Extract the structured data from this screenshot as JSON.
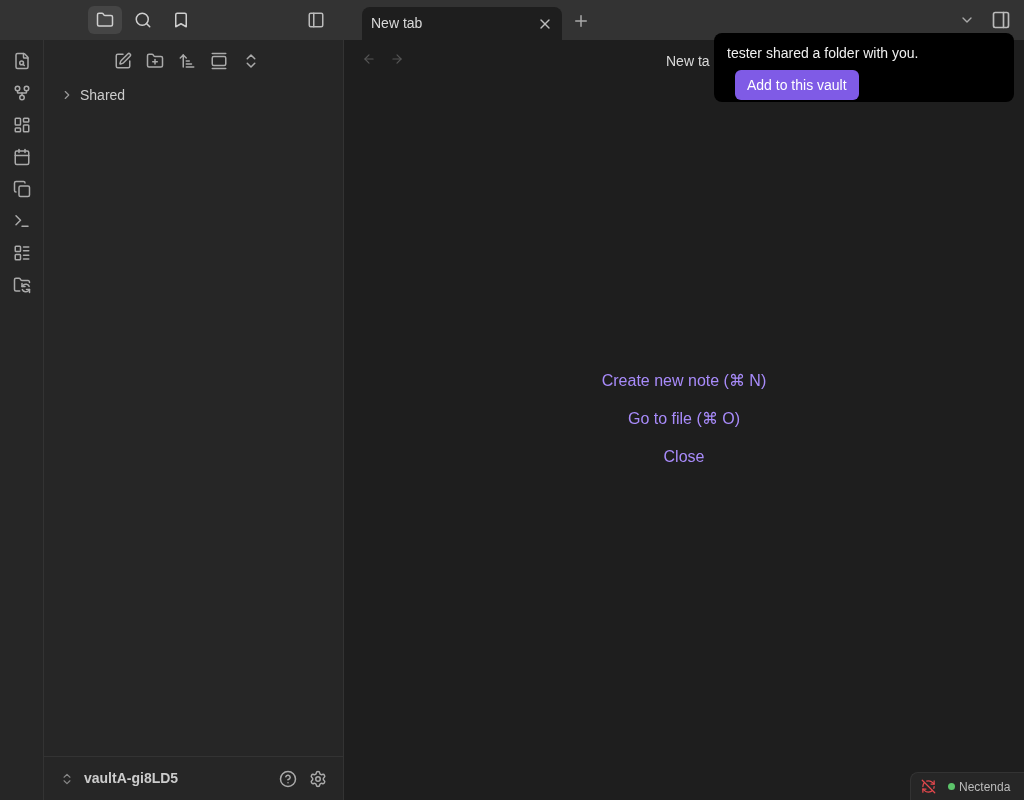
{
  "sidebar_tabs": [
    {
      "kind": "files",
      "selected": true
    },
    {
      "kind": "search",
      "selected": false
    },
    {
      "kind": "bookmarks",
      "selected": false
    }
  ],
  "tabs": [
    {
      "label": "New tab",
      "selected": true
    }
  ],
  "file_explorer": {
    "items": [
      {
        "label": "Shared",
        "expanded": false
      }
    ]
  },
  "vault": {
    "name": "vaultA-gi8LD5"
  },
  "view": {
    "title": "New ta",
    "actions": [
      "Create new note (⌘ N)",
      "Go to file (⌘ O)",
      "Close"
    ]
  },
  "notice": {
    "message": "tester shared a folder with you.",
    "button": "Add to this vault"
  },
  "status_bar": {
    "name": "Nectenda",
    "color": "#5cc46a"
  }
}
